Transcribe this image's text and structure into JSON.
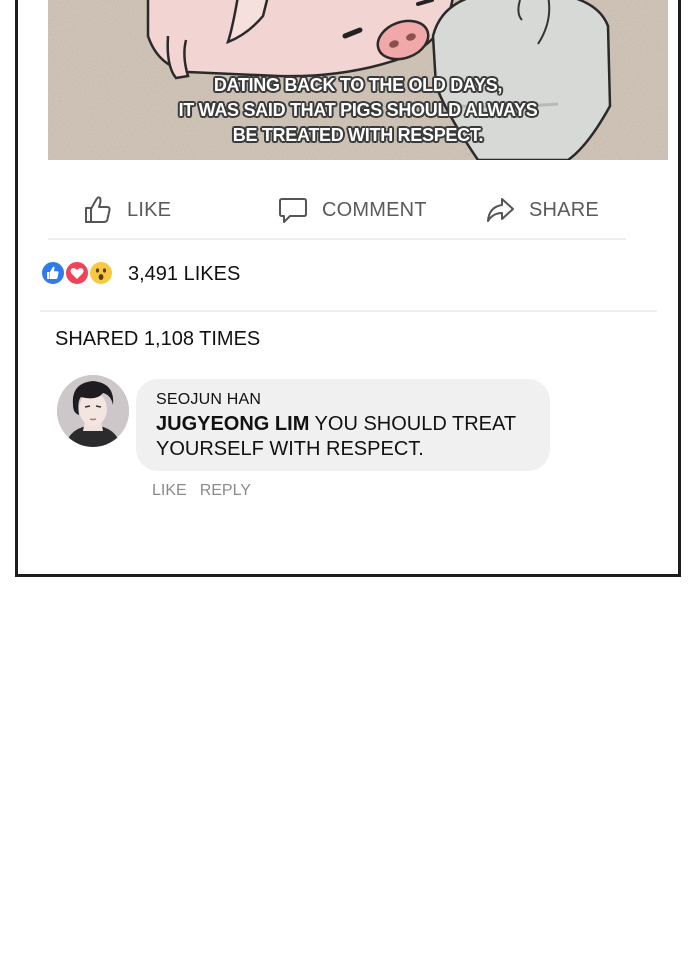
{
  "post": {
    "caption_lines": [
      "DATING BACK TO THE OLD DAYS,",
      "IT WAS SAID THAT PIGS SHOULD ALWAYS",
      "BE TREATED WITH RESPECT."
    ]
  },
  "actions": {
    "like_label": "LIKE",
    "comment_label": "COMMENT",
    "share_label": "SHARE",
    "like_icon": "thumbs-up-icon",
    "comment_icon": "speech-bubble-icon",
    "share_icon": "share-arrow-icon"
  },
  "reactions": {
    "icons": [
      "like-reaction-icon",
      "love-reaction-icon",
      "wow-reaction-icon"
    ],
    "colors": {
      "like": "#2f7be9",
      "love": "#f1425a",
      "wow": "#f7c942"
    },
    "likes_text": "3,491 LIKES"
  },
  "shares": {
    "text": "SHARED 1,108 TIMES"
  },
  "comment": {
    "author": "SEOJUN HAN",
    "mention": "JUGYEONG LIM",
    "text": " YOU SHOULD TREAT YOURSELF WITH RESPECT.",
    "like_label": "LIKE",
    "reply_label": "REPLY"
  }
}
